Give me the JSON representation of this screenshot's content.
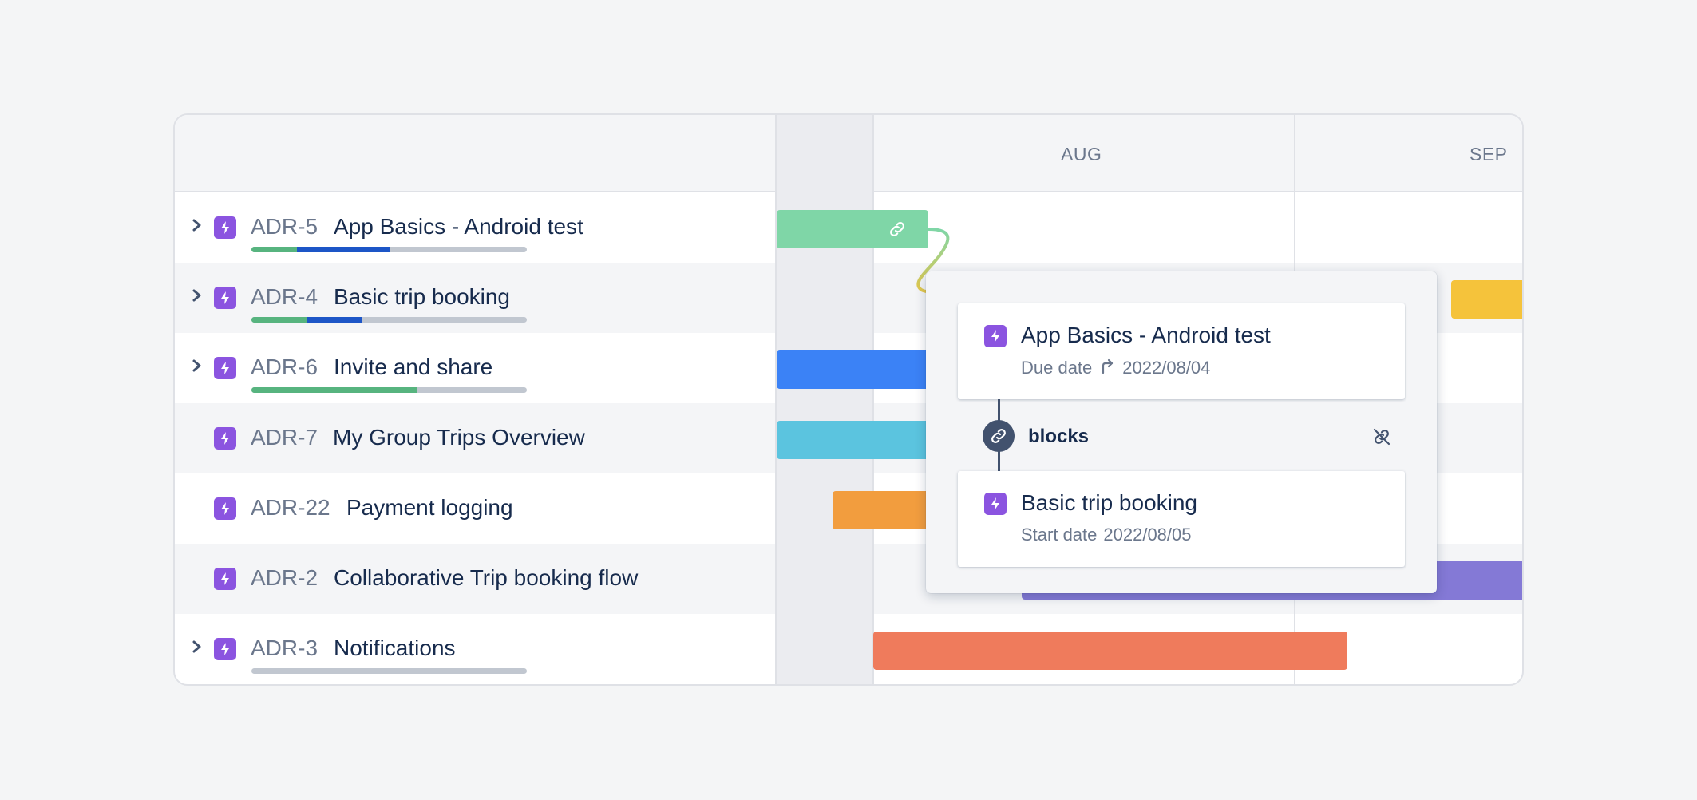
{
  "timeline": {
    "months": [
      "AUG",
      "SEP"
    ]
  },
  "issues": [
    {
      "key": "ADR-5",
      "title": "App Basics - Android test",
      "expandable": true,
      "progress": {
        "done": 0.165,
        "in_progress": 0.335
      },
      "bar_color": "#7fd6a7"
    },
    {
      "key": "ADR-4",
      "title": "Basic trip booking",
      "expandable": true,
      "progress": {
        "done": 0.2,
        "in_progress": 0.2
      },
      "bar_color": "#f5c33b"
    },
    {
      "key": "ADR-6",
      "title": "Invite and share",
      "expandable": true,
      "progress": {
        "done": 0.6,
        "in_progress": 0
      },
      "bar_color": "#3b82f6"
    },
    {
      "key": "ADR-7",
      "title": "My Group Trips Overview",
      "expandable": false,
      "bar_color": "#5bc4df"
    },
    {
      "key": "ADR-22",
      "title": "Payment logging",
      "expandable": false,
      "bar_color": "#f29d3e"
    },
    {
      "key": "ADR-2",
      "title": "Collaborative Trip booking flow",
      "expandable": false,
      "bar_color": "#8479d6"
    },
    {
      "key": "ADR-3",
      "title": "Notifications",
      "expandable": true,
      "progress": {
        "done": 0,
        "in_progress": 0
      },
      "bar_color": "#ef7b5c"
    }
  ],
  "dependency_popup": {
    "source": {
      "title": "App Basics - Android test",
      "date_label": "Due date",
      "date": "2022/08/04"
    },
    "relation": "blocks",
    "target": {
      "title": "Basic trip booking",
      "date_label": "Start date",
      "date": "2022/08/05"
    }
  },
  "colors": {
    "epic": "#8b54e0",
    "progress_done": "#57b47f",
    "progress_in_progress": "#1d56c7",
    "progress_todo": "#c1c7d0",
    "dependency_line_start": "#7fd6a7",
    "dependency_line_end": "#e6c84a"
  },
  "icons": {
    "expand": "chevron-right-icon",
    "epic": "lightning-icon",
    "link": "link-icon",
    "unlink": "unlink-icon",
    "due_date": "arrow-turn-icon"
  }
}
